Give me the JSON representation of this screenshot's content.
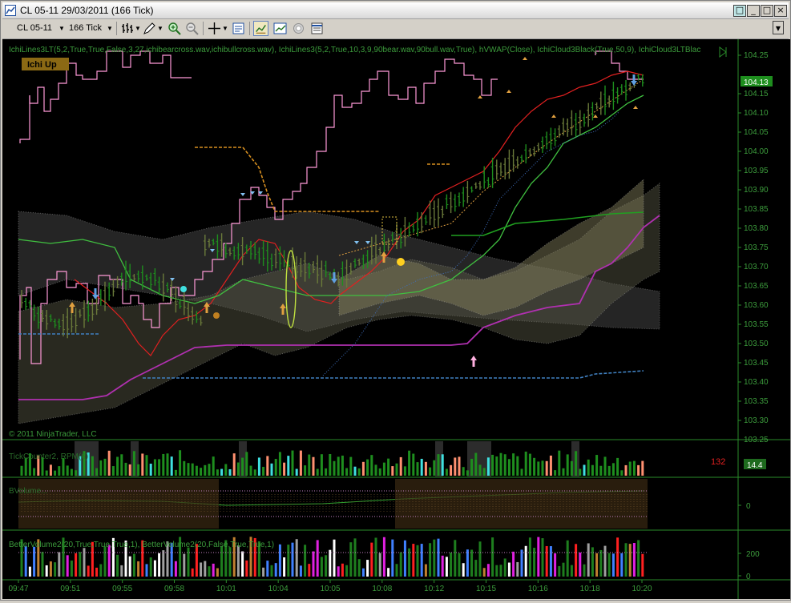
{
  "window": {
    "title": "CL 05-11  29/03/2011 (166 Tick)",
    "buttons": [
      "_",
      "□",
      "×"
    ]
  },
  "toolbar": {
    "instrument": "CL 05-11",
    "interval": "166 Tick",
    "menu_arrow": "▼"
  },
  "price_panel": {
    "indicator_labels": "IchiLines3LT(5,2,True,True,False,3,27,ichibearcross.wav,ichibullcross.wav), IchiLines3(5,2,True,10,3,9,90bear.wav,90bull.wav,True), hVWAP(Close), IchiCloud3Black(True,50,9), IchiCloud3LTBlac",
    "signal_badge": "Ichi Up",
    "last_price": "104.13",
    "copyright": "© 2011 NinjaTrader, LLC",
    "y_ticks": [
      "104.25",
      "104.15",
      "104.10",
      "104.05",
      "104.00",
      "103.95",
      "103.90",
      "103.85",
      "103.80",
      "103.75",
      "103.70",
      "103.65",
      "103.60",
      "103.55",
      "103.50",
      "103.45",
      "103.40",
      "103.35",
      "103.30",
      "103.25"
    ]
  },
  "tick_panel": {
    "label": "TickCounter2,  RPM(6)",
    "count": "132",
    "value": "14.4"
  },
  "osc_panel": {
    "label": "BVolume...",
    "zero_label": "0"
  },
  "volume_panel": {
    "label": "BetterVolume2(20,True,True,True,1), BetterVolume2(20,False,True,True,1)",
    "ticks": [
      "200",
      "0"
    ]
  },
  "time_axis": [
    "09:47",
    "09:51",
    "09:55",
    "09:58",
    "10:01",
    "10:04",
    "10:05",
    "10:08",
    "10:12",
    "10:15",
    "10:16",
    "10:18",
    "10:20"
  ],
  "colors": {
    "background": "#000000",
    "text_green": "#3c9c3c",
    "axis_green": "#2a8c2a",
    "badge": "#8b6914",
    "bull_bar": "#1e8e1e",
    "bear_bar": "#6a7a3a",
    "pink_line": "#ff9ad8",
    "red_line": "#e02020",
    "green_line": "#40c040",
    "purple_line": "#b030b0",
    "vwap_dash": "#d89020",
    "blue_dash": "#4080c0",
    "cloud": "#5a5a46",
    "cyan": "#40e0e0",
    "salmon": "#ff9070"
  }
}
